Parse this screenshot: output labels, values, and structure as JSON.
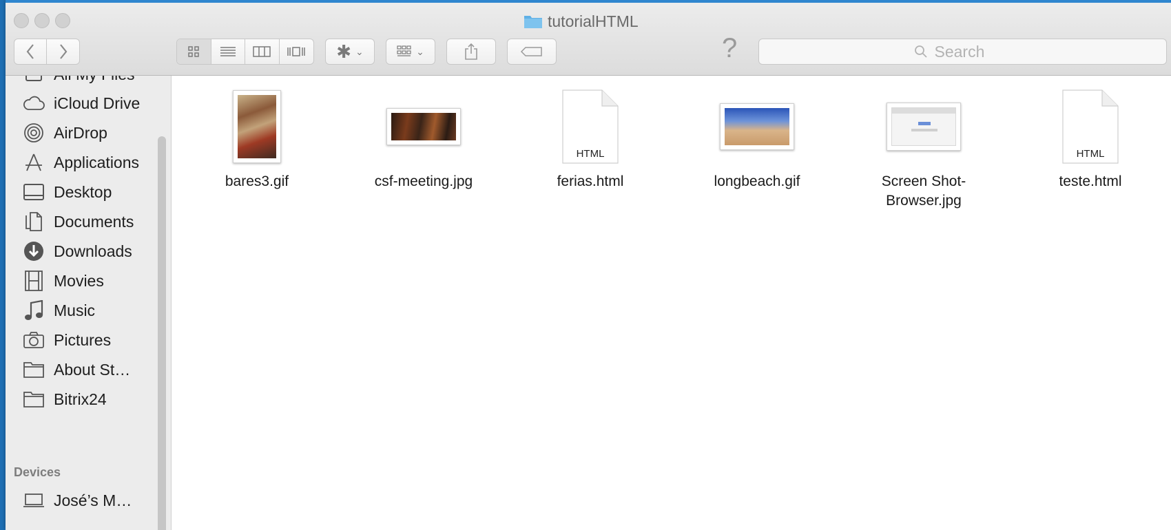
{
  "window": {
    "title": "tutorialHTML"
  },
  "toolbar": {
    "back_icon": "chevron-left-icon",
    "forward_icon": "chevron-right-icon",
    "view_modes": [
      "icon-view-icon",
      "list-view-icon",
      "column-view-icon",
      "cover-flow-icon"
    ],
    "active_view": "icon-view-icon",
    "action_icon": "gear-icon",
    "arrange_icon": "arrange-grid-icon",
    "share_icon": "share-icon",
    "tag_icon": "tag-icon",
    "help_label": "?",
    "search_placeholder": "Search"
  },
  "sidebar": {
    "partial_item": "All My Files",
    "items": [
      {
        "label": "iCloud Drive",
        "icon": "cloud-icon"
      },
      {
        "label": "AirDrop",
        "icon": "airdrop-icon"
      },
      {
        "label": "Applications",
        "icon": "applications-icon"
      },
      {
        "label": "Desktop",
        "icon": "desktop-icon"
      },
      {
        "label": "Documents",
        "icon": "documents-icon"
      },
      {
        "label": "Downloads",
        "icon": "downloads-icon"
      },
      {
        "label": "Movies",
        "icon": "movies-icon"
      },
      {
        "label": "Music",
        "icon": "music-icon"
      },
      {
        "label": "Pictures",
        "icon": "camera-icon"
      },
      {
        "label": "About St…",
        "icon": "folder-icon"
      },
      {
        "label": "Bitrix24",
        "icon": "folder-icon"
      }
    ],
    "devices_header": "Devices",
    "devices": [
      {
        "label": "José’s M…",
        "icon": "laptop-icon"
      }
    ]
  },
  "files": [
    {
      "name": "bares3.gif",
      "kind": "image"
    },
    {
      "name": "csf-meeting.jpg",
      "kind": "image"
    },
    {
      "name": "ferias.html",
      "kind": "html",
      "badge": "HTML"
    },
    {
      "name": "longbeach.gif",
      "kind": "image"
    },
    {
      "name": "Screen Shot-Browser.jpg",
      "kind": "image"
    },
    {
      "name": "teste.html",
      "kind": "html",
      "badge": "HTML"
    }
  ],
  "colors": {
    "desktop_blue": "#1e6fb4",
    "folder_blue": "#5fb0e6"
  }
}
